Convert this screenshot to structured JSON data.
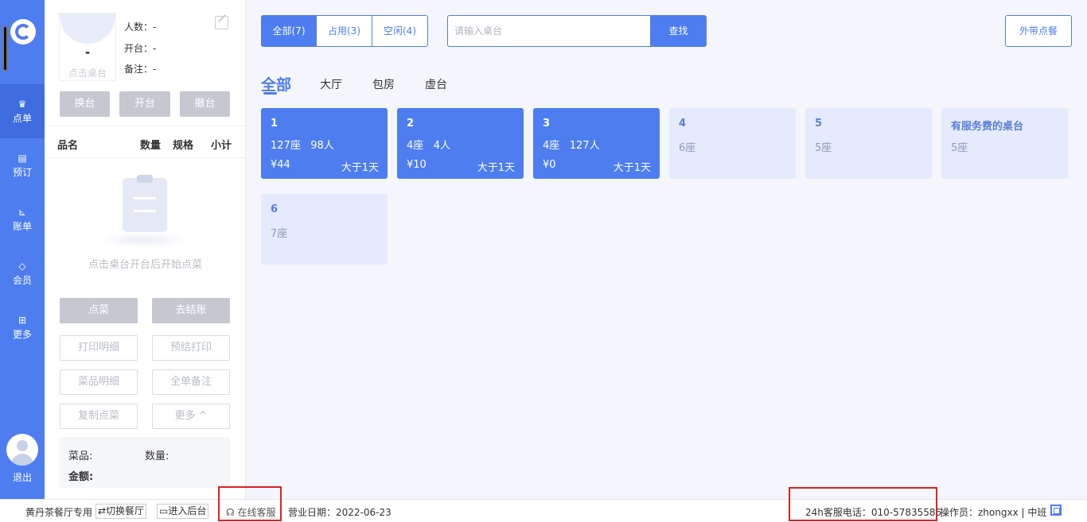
{
  "nav": {
    "items": [
      {
        "label": "点单",
        "icon": "chef-hat-icon"
      },
      {
        "label": "预订",
        "icon": "booking-icon"
      },
      {
        "label": "账单",
        "icon": "chart-icon"
      },
      {
        "label": "会员",
        "icon": "diamond-icon"
      },
      {
        "label": "更多",
        "icon": "grid-icon"
      }
    ],
    "exit_label": "退出"
  },
  "order": {
    "table_dash": "-",
    "table_hint": "点击桌台",
    "people_label": "人数：-",
    "open_label": "开台：-",
    "remark_label": "备注：-",
    "btn_switch": "换台",
    "btn_open": "开台",
    "btn_cancel": "撤台",
    "col_name": "品名",
    "col_qty": "数量",
    "col_spec": "规格",
    "col_subtotal": "小计",
    "empty_text": "点击桌台开台后开始点菜",
    "btn_order": "点菜",
    "btn_checkout": "去结账",
    "btn_print_detail": "打印明细",
    "btn_pre_print": "预结打印",
    "btn_dish_detail": "菜品明细",
    "btn_order_remark": "全单备注",
    "btn_copy": "复制点菜",
    "btn_more": "更多 ^",
    "sum_dish": "菜品:",
    "sum_qty": "数量:",
    "sum_amount": "金额:"
  },
  "filter": {
    "all": "全部(7)",
    "occupied": "占用(3)",
    "idle": "空闲(4)",
    "search_placeholder": "请输入桌台",
    "find_label": "查找",
    "takeout_label": "外带点餐"
  },
  "areas": [
    "全部",
    "大厅",
    "包房",
    "虚台"
  ],
  "tables": [
    {
      "no": "1",
      "seats": "127座",
      "people": "98人",
      "price": "¥44",
      "duration": "大于1天",
      "status": "busy"
    },
    {
      "no": "2",
      "seats": "4座",
      "people": "4人",
      "price": "¥10",
      "duration": "大于1天",
      "status": "busy"
    },
    {
      "no": "3",
      "seats": "4座",
      "people": "127人",
      "price": "¥0",
      "duration": "大于1天",
      "status": "busy"
    },
    {
      "no": "4",
      "seats": "6座",
      "status": "idle"
    },
    {
      "no": "5",
      "seats": "5座",
      "status": "idle"
    },
    {
      "no": "有服务费的桌台",
      "seats": "5座",
      "status": "idle"
    },
    {
      "no": "6",
      "seats": "7座",
      "status": "idle"
    }
  ],
  "footer": {
    "shop": "黄丹茶餐厅专用",
    "switch_shop": "⇄切换餐厅",
    "enter_backend": "进入后台",
    "service": "在线客服",
    "biz_date": "营业日期：2022-06-23",
    "hotline": "24h客服电话：010-57835586",
    "operator": "操作员：zhongxx | 中班"
  },
  "colors": {
    "accent": "#4e7df0",
    "idle_card": "#e5ebfc",
    "highlight": "#e02020"
  }
}
